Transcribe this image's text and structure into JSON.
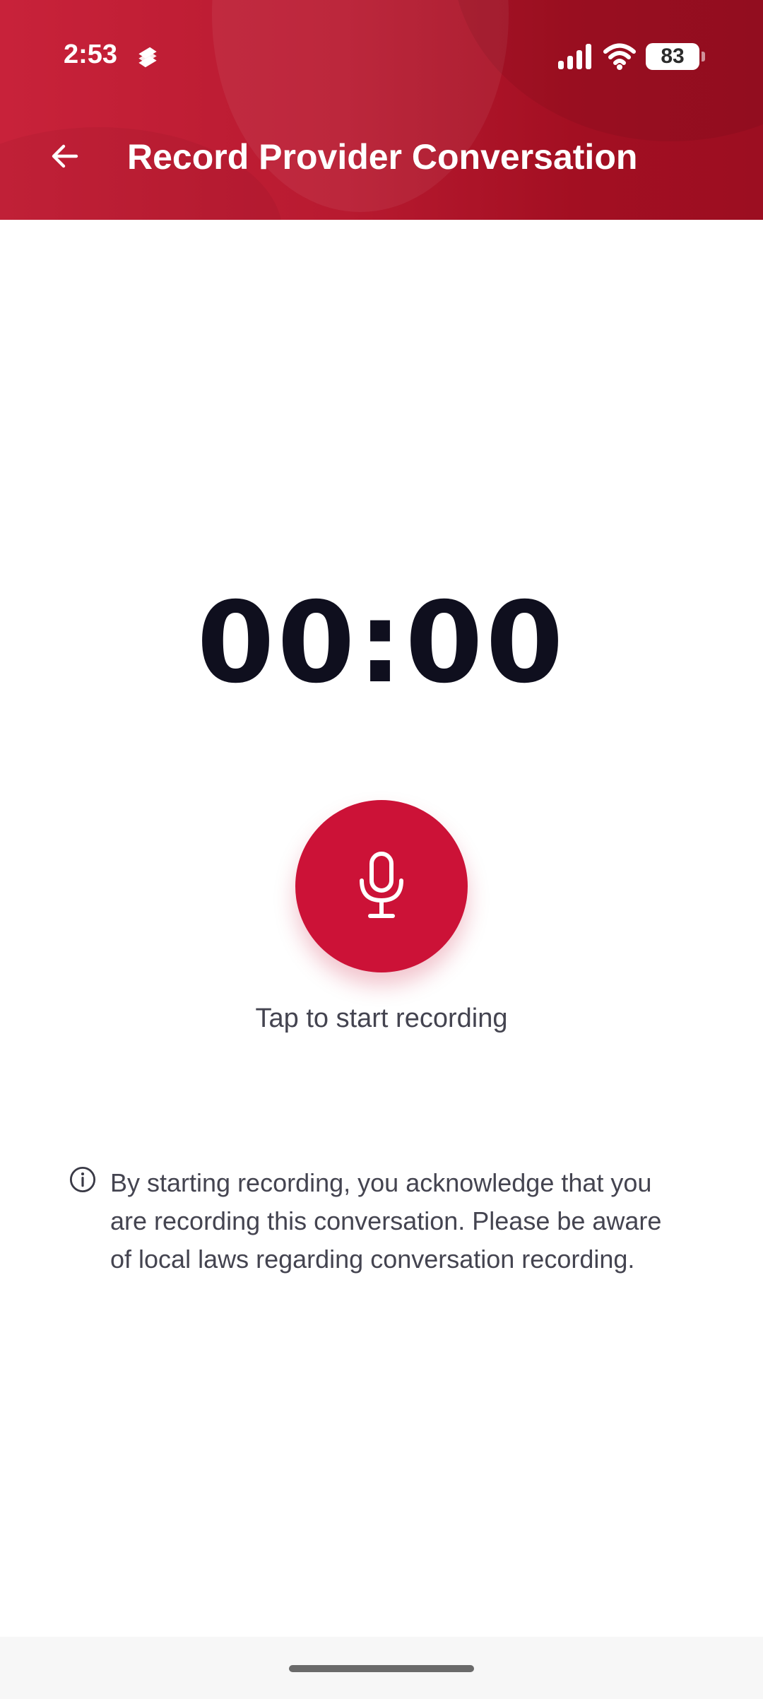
{
  "status_bar": {
    "time": "2:53",
    "battery": "83",
    "icons": [
      "app-notification-icon",
      "signal-icon",
      "wifi-icon",
      "battery-icon"
    ]
  },
  "app_bar": {
    "title": "Record Provider Conversation",
    "back_icon": "arrow-left-icon"
  },
  "recorder": {
    "timer": "00:00",
    "button_icon": "microphone-icon",
    "hint": "Tap to start recording"
  },
  "disclaimer": {
    "icon": "info-icon",
    "text": "By starting recording, you acknowledge that you are recording this conversation. Please be aware of local laws regarding conversation recording."
  },
  "colors": {
    "header": "#b81a30",
    "accent": "#cc1237",
    "timer_text": "#0f0f1e",
    "body_text": "#444450"
  }
}
